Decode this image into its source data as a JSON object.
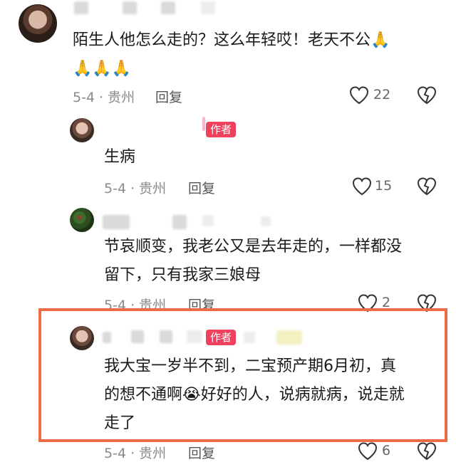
{
  "comments": [
    {
      "text_line1": "陌生人他怎么走的？这么年轻哎！老天不公",
      "emoji_line1": "🙏",
      "emoji_line2": "🙏🙏🙏",
      "date": "5-4",
      "location": "· 贵州",
      "reply_label": "回复",
      "likes": "22"
    },
    {
      "text": "生病",
      "badge": "作者",
      "date": "5-4",
      "location": "· 贵州",
      "reply_label": "回复",
      "likes": "15"
    },
    {
      "text_line1": "节哀顺变，我老公又是去年走的，一样都没",
      "text_line2": "留下，只有我家三娘母",
      "date": "5-4",
      "location": "· 贵州",
      "reply_label": "回复",
      "likes": "2"
    },
    {
      "badge": "作者",
      "text_line1": "我大宝一岁半不到，二宝预产期6月初，真",
      "text_line2a": "的想不通啊",
      "emoji": "😭",
      "text_line2b": "好好的人，说病就病，说走就",
      "text_line3": "走了",
      "date": "5-4",
      "location": "· 贵州",
      "reply_label": "回复",
      "likes": "6"
    }
  ],
  "colors": {
    "highlight": "#ee6b45",
    "badge": "#f0405e"
  }
}
